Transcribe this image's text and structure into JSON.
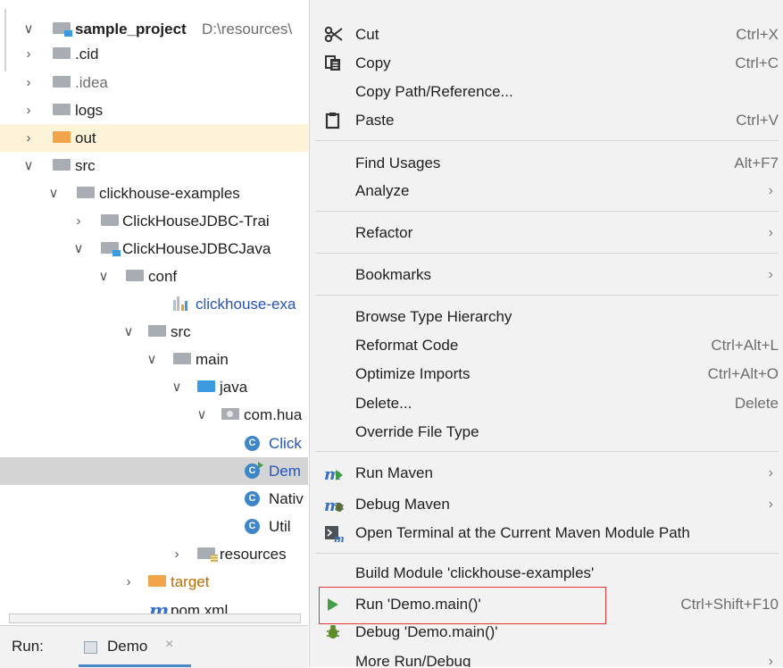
{
  "project_tree": {
    "items": [
      {
        "name": "sample_project",
        "path": "D:\\resources\\"
      },
      {
        "name": ".cid"
      },
      {
        "name": ".idea"
      },
      {
        "name": "logs"
      },
      {
        "name": "out"
      },
      {
        "name": "src"
      },
      {
        "name": "clickhouse-examples"
      },
      {
        "name": "ClickHouseJDBC-Trai"
      },
      {
        "name": "ClickHouseJDBCJava"
      },
      {
        "name": "conf"
      },
      {
        "name": "clickhouse-exa"
      },
      {
        "name": "src"
      },
      {
        "name": "main"
      },
      {
        "name": "java"
      },
      {
        "name": "com.hua"
      },
      {
        "name": "Click"
      },
      {
        "name": "Dem"
      },
      {
        "name": "Nativ"
      },
      {
        "name": "Util"
      },
      {
        "name": "resources"
      },
      {
        "name": "target"
      },
      {
        "name": "pom.xml"
      }
    ],
    "class_icon_letter": "C",
    "maven_icon_letter": "m"
  },
  "run_bar": {
    "label": "Run:",
    "tab_name": "Demo",
    "close_glyph": "×"
  },
  "context_menu": {
    "items": [
      {
        "label": "Cut",
        "shortcut": "Ctrl+X",
        "icon": "scissors-icon"
      },
      {
        "label": "Copy",
        "shortcut": "Ctrl+C",
        "icon": "copy-icon"
      },
      {
        "label": "Copy Path/Reference...",
        "shortcut": ""
      },
      {
        "label": "Paste",
        "shortcut": "Ctrl+V",
        "icon": "clipboard-icon"
      },
      {
        "label": "Find Usages",
        "shortcut": "Alt+F7"
      },
      {
        "label": "Analyze",
        "submenu": true
      },
      {
        "label": "Refactor",
        "submenu": true
      },
      {
        "label": "Bookmarks",
        "submenu": true
      },
      {
        "label": "Browse Type Hierarchy",
        "shortcut": ""
      },
      {
        "label": "Reformat Code",
        "shortcut": "Ctrl+Alt+L"
      },
      {
        "label": "Optimize Imports",
        "shortcut": "Ctrl+Alt+O"
      },
      {
        "label": "Delete...",
        "shortcut": "Delete"
      },
      {
        "label": "Override File Type",
        "shortcut": ""
      },
      {
        "label": "Run Maven",
        "submenu": true,
        "icon": "run-maven-icon"
      },
      {
        "label": "Debug Maven",
        "submenu": true,
        "icon": "debug-maven-icon"
      },
      {
        "label": "Open Terminal at the Current Maven Module Path",
        "icon": "maven-terminal-icon"
      },
      {
        "label": "Build Module 'clickhouse-examples'",
        "shortcut": ""
      },
      {
        "label": "Run 'Demo.main()'",
        "shortcut": "Ctrl+Shift+F10",
        "icon": "run-icon",
        "highlighted": true
      },
      {
        "label": "Debug 'Demo.main()'",
        "shortcut": "",
        "icon": "debug-icon"
      },
      {
        "label": "More Run/Debug",
        "submenu": true
      }
    ],
    "submenu_glyph": "›"
  },
  "colors": {
    "menu_bg": "#f2f2f2",
    "selection_bg": "#d4d4d4",
    "highlight_border": "#e2363c",
    "folder_grey": "#a8adb3",
    "folder_blue": "#3c9be0",
    "folder_orange": "#f1a449",
    "class_icon": "#3e86c9",
    "run_green": "#43a047"
  }
}
